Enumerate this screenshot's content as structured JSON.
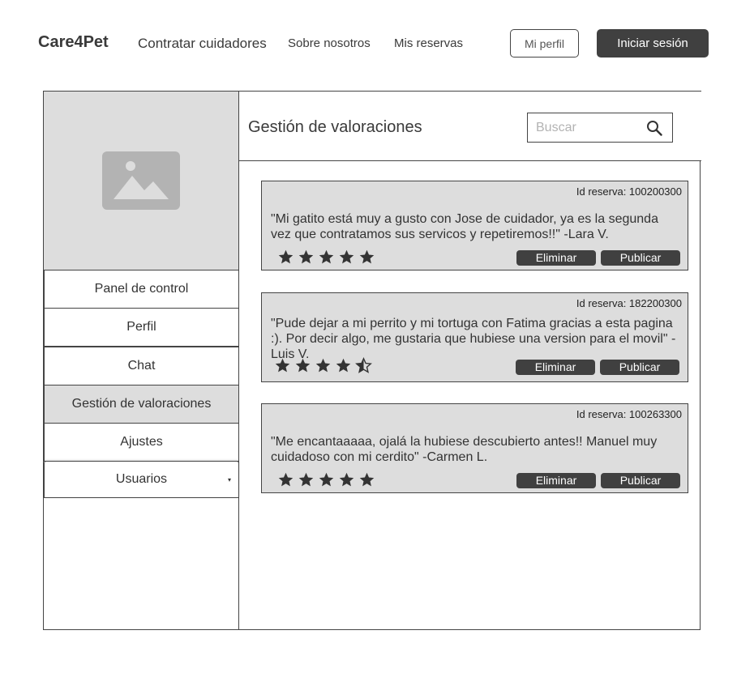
{
  "header": {
    "brand": "Care4Pet",
    "nav": {
      "hire": "Contratar cuidadores",
      "about": "Sobre nosotros",
      "bookings": "Mis reservas"
    },
    "profile_button": "Mi perfil",
    "login_button": "Iniciar sesión"
  },
  "sidebar": {
    "image_icon": "image-placeholder-icon",
    "items": [
      {
        "label": "Panel de control"
      },
      {
        "label": "Perfil"
      },
      {
        "label": "Chat"
      },
      {
        "label": "Gestión de valoraciones",
        "active": true
      },
      {
        "label": "Ajustes"
      },
      {
        "label": "Usuarios",
        "has_dropdown": true
      }
    ],
    "dropdown_caret": "▾"
  },
  "main": {
    "title": "Gestión de valoraciones",
    "search": {
      "placeholder": "Buscar",
      "value": "",
      "icon": "search-icon"
    }
  },
  "reviews": [
    {
      "id_label": "Id reserva: 100200300",
      "text": "\"Mi gatito está muy a gusto con Jose de cuidador, ya es la segunda vez que contratamos sus servicos y repetiremos!!\" -Lara V.",
      "rating": 5,
      "delete_label": "Eliminar",
      "publish_label": "Publicar"
    },
    {
      "id_label": "Id reserva: 182200300",
      "text": "\"Pude dejar a mi perrito y mi tortuga con Fatima gracias a esta pagina :). Por decir algo, me gustaria que hubiese una version para el movil\" -Luis V.",
      "rating": 4.5,
      "delete_label": "Eliminar",
      "publish_label": "Publicar"
    },
    {
      "id_label": "Id reserva: 100263300",
      "text": "\"Me encantaaaaa, ojalá la hubiese descubierto antes!! Manuel muy cuidadoso con mi cerdito\" -Carmen L.",
      "rating": 5,
      "delete_label": "Eliminar",
      "publish_label": "Publicar"
    }
  ],
  "colors": {
    "dark_button": "#404040",
    "panel_gray": "#dddddd",
    "border": "#444444",
    "placeholder_icon": "#b3b3b3"
  }
}
